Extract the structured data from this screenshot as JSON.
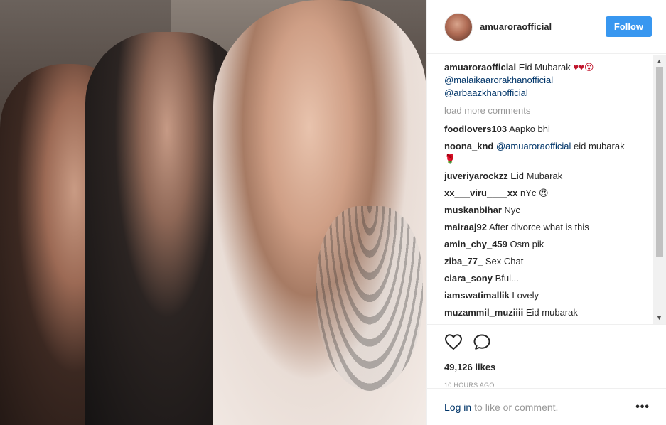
{
  "post": {
    "username": "amuaroraofficial",
    "follow_label": "Follow",
    "caption": {
      "user": "amuaroraofficial",
      "text": "Eid Mubarak",
      "emoji": "♥♥😮",
      "mentions": [
        "@malaikaarorakhanofficial",
        "@arbaazkhanofficial"
      ]
    },
    "load_more": "load more comments",
    "comments": [
      {
        "user": "foodlovers103",
        "text": "Aapko bhi"
      },
      {
        "user": "noona_knd",
        "mention": "@amuaroraofficial",
        "text": "eid mubarak",
        "emoji": "🌹"
      },
      {
        "user": "juveriyarockzz",
        "text": "Eid Mubarak"
      },
      {
        "user": "xx___viru____xx",
        "text": "nYc",
        "emoji": "😍"
      },
      {
        "user": "muskanbihar",
        "text": "Nyc"
      },
      {
        "user": "mairaaj92",
        "text": "After divorce what is this"
      },
      {
        "user": "amin_chy_459",
        "text": "Osm pik"
      },
      {
        "user": "ziba_77_",
        "text": "Sex Chat"
      },
      {
        "user": "ciara_sony",
        "text": "Bful..."
      },
      {
        "user": "iamswatimallik",
        "text": "Lovely"
      },
      {
        "user": "muzammil_muziiii",
        "text": "Eid mubarak"
      }
    ],
    "likes": "49,126 likes",
    "time": "10 HOURS AGO",
    "login_link": "Log in",
    "login_rest": "to like or comment.",
    "more_label": "•••"
  },
  "icons": {
    "like": "heart-outline-icon",
    "comment": "comment-bubble-icon",
    "more": "more-options-icon"
  },
  "colors": {
    "follow": "#3897f0",
    "link": "#003569",
    "muted": "#999999"
  }
}
